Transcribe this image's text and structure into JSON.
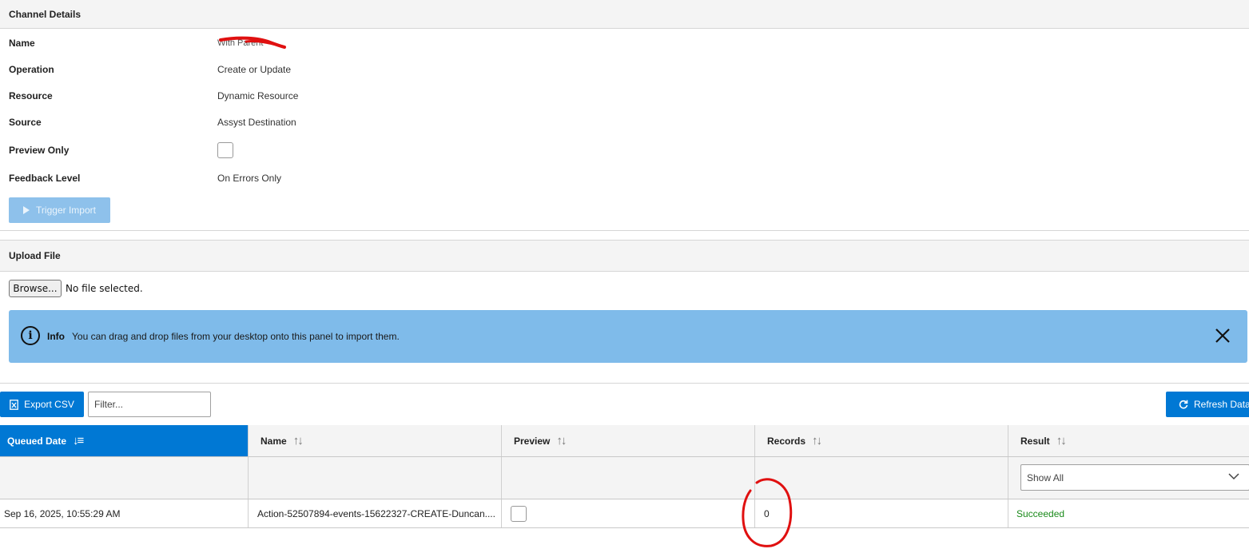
{
  "channel_details": {
    "title": "Channel Details",
    "rows": {
      "name": {
        "label": "Name",
        "value": "With Parent"
      },
      "operation": {
        "label": "Operation",
        "value": "Create or Update"
      },
      "resource": {
        "label": "Resource",
        "value": "Dynamic Resource"
      },
      "source": {
        "label": "Source",
        "value": "Assyst Destination"
      },
      "preview_only": {
        "label": "Preview Only",
        "checked": false
      },
      "feedback_level": {
        "label": "Feedback Level",
        "value": "On Errors Only"
      }
    },
    "trigger_button": {
      "label": "Trigger Import",
      "icon": "play-icon",
      "disabled": true
    }
  },
  "upload_file": {
    "title": "Upload File",
    "browse_label": "Browse...",
    "file_status": "No file selected.",
    "info_banner": {
      "title": "Info",
      "message": "You can drag and drop files from your desktop onto this panel to import them.",
      "icon": "info-icon",
      "close_icon": "close-icon"
    }
  },
  "toolbar": {
    "export_label": "Export CSV",
    "export_icon": "file-excel-icon",
    "filter_placeholder": "Filter...",
    "refresh_label": "Refresh Data",
    "refresh_icon": "refresh-icon"
  },
  "table": {
    "columns": [
      {
        "label": "Queued Date",
        "sort": "descending",
        "active": true
      },
      {
        "label": "Name",
        "sort": "none"
      },
      {
        "label": "Preview",
        "sort": "none"
      },
      {
        "label": "Records",
        "sort": "none"
      },
      {
        "label": "Result",
        "sort": "none"
      }
    ],
    "result_filter": {
      "selected": "Show All"
    },
    "rows": [
      {
        "queued_date": "Sep 16, 2025, 10:55:29 AM",
        "name": "Action-52507894-events-15622327-CREATE-Duncan....",
        "preview": false,
        "records": "0",
        "result": "Succeeded"
      }
    ]
  },
  "colors": {
    "accent": "#0078d4",
    "info_banner": "#7fbbea",
    "success": "#1a8a1a",
    "annotation": "#e01010"
  }
}
